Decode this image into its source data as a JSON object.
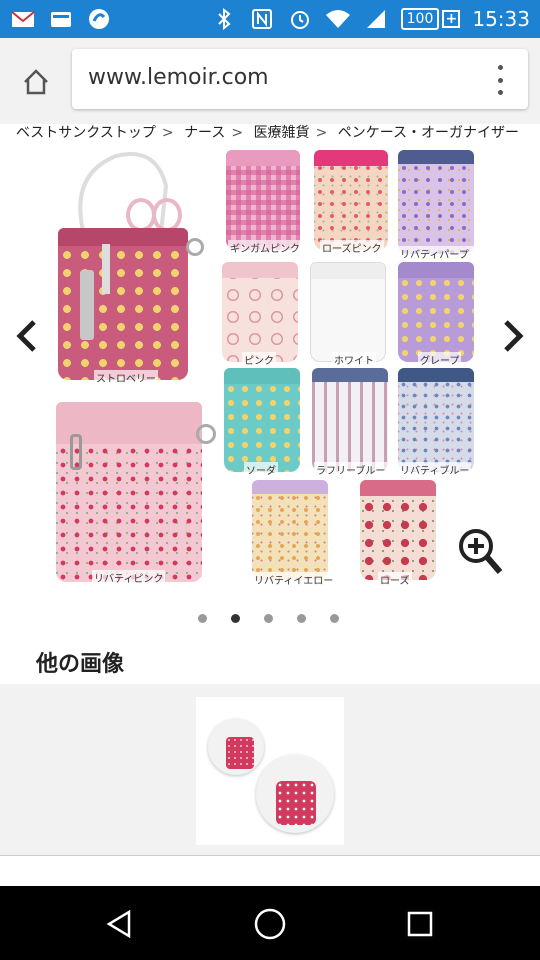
{
  "status_bar": {
    "battery": "100",
    "time": "15:33",
    "colors": {
      "bg": "#1e82d2"
    }
  },
  "browser": {
    "url": "www.lemoir.com"
  },
  "breadcrumb": [
    "ベストサンクストップ",
    "ナース",
    "医療雑貨",
    "ペンケース・オーガナイザー"
  ],
  "gallery": {
    "labels": {
      "strawberry": "ストロベリー",
      "liberty_pink": "リバティピンク",
      "gingham_pink": "ギンガムピンク",
      "rose_pink": "ローズピンク",
      "liberty_purple": "リバティパープル",
      "pink": "ピンク",
      "white": "ホワイト",
      "grape": "グレープ",
      "soda": "ソーダ",
      "ruffle_blue": "ラフリーブルー",
      "liberty_blue": "リバティブルー",
      "liberty_yellow": "リバティイエロー",
      "rose": "ローズ"
    },
    "pager": {
      "count": 5,
      "active": 2
    }
  },
  "other_images": {
    "title": "他の画像"
  }
}
